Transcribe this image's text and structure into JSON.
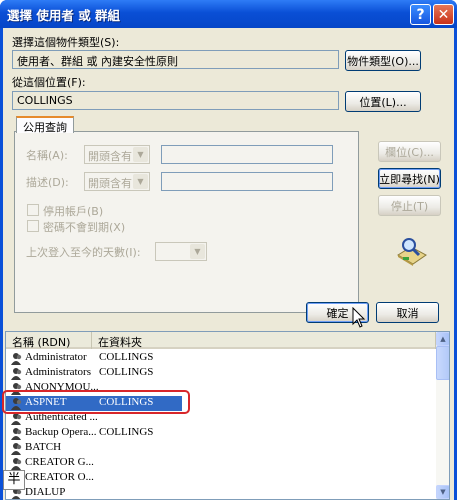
{
  "window": {
    "title": "選擇 使用者 或 群組",
    "help_glyph": "?",
    "close_glyph": "✕"
  },
  "object_type": {
    "label": "選擇這個物件類型(S):",
    "value": "使用者、群組 或 內建安全性原則",
    "button": "物件類型(O)..."
  },
  "location": {
    "label": "從這個位置(F):",
    "value": "COLLINGS",
    "button": "位置(L)..."
  },
  "tab": {
    "label": "公用查詢"
  },
  "query": {
    "name_label": "名稱(A):",
    "name_op": "開頭含有",
    "desc_label": "描述(D):",
    "desc_op": "開頭含有",
    "disabled_accounts": "停用帳戶(B)",
    "no_expire_pwd": "密碼不會到期(X)",
    "days_since_logon": "上次登入至今的天數(I):"
  },
  "side_buttons": {
    "columns": "欄位(C)...",
    "find_now": "立即尋找(N)",
    "stop": "停止(T)"
  },
  "dialog_buttons": {
    "ok": "確定",
    "cancel": "取消"
  },
  "results": {
    "columns": [
      "名稱 (RDN)",
      "在資料夾"
    ],
    "rows": [
      {
        "name": "Administrator",
        "folder": "COLLINGS"
      },
      {
        "name": "Administrators",
        "folder": "COLLINGS"
      },
      {
        "name": "ANONYMOU...",
        "folder": ""
      },
      {
        "name": "ASPNET",
        "folder": "COLLINGS",
        "selected": true
      },
      {
        "name": "Authenticated ...",
        "folder": ""
      },
      {
        "name": "Backup Opera...",
        "folder": "COLLINGS"
      },
      {
        "name": "BATCH",
        "folder": ""
      },
      {
        "name": "CREATOR G...",
        "folder": ""
      },
      {
        "name": "CREATOR O...",
        "folder": ""
      },
      {
        "name": "DIALUP",
        "folder": ""
      }
    ]
  },
  "ime": {
    "glyph": "半"
  },
  "colors": {
    "titlebar": "#0a50d8",
    "dialog_bg": "#ece9d8",
    "selection": "#316ac5",
    "highlight_box": "#d8262a"
  }
}
